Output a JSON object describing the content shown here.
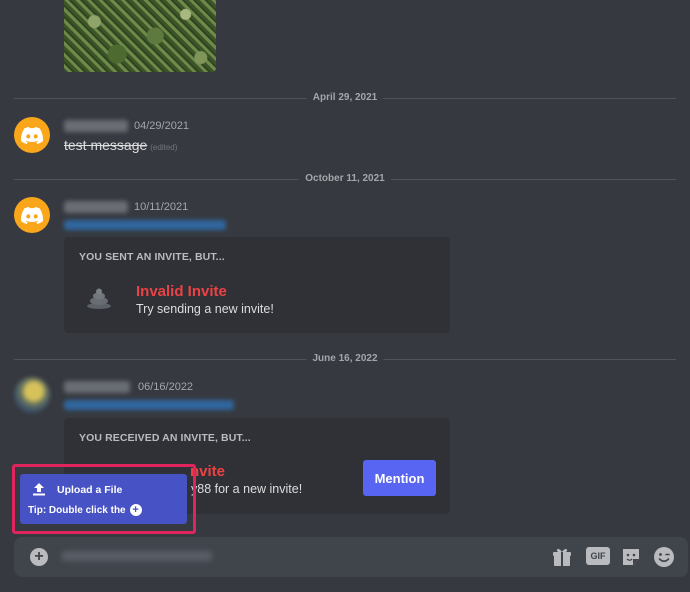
{
  "dividers": [
    {
      "label": "April 29, 2021"
    },
    {
      "label": "October 11, 2021"
    },
    {
      "label": "June 16, 2022"
    }
  ],
  "messages": [
    {
      "timestamp": "04/29/2021",
      "text": "test message",
      "edited": "(edited)"
    },
    {
      "timestamp": "10/11/2021"
    },
    {
      "timestamp": "06/16/2022"
    }
  ],
  "invite_sent": {
    "title": "YOU SENT AN INVITE, BUT...",
    "name": "Invalid Invite",
    "subtitle": "Try sending a new invite!"
  },
  "invite_received": {
    "title": "YOU RECEIVED AN INVITE, BUT...",
    "name_partial": "nvite",
    "subtitle_partial": "y88 for a new invite!",
    "mention_label": "Mention"
  },
  "upload_popup": {
    "upload_label": "Upload a File",
    "tip_text": "Tip: Double click the"
  },
  "composer": {
    "gif_label": "GIF"
  },
  "colors": {
    "background": "#36393f",
    "card": "#2f3136",
    "accent": "#5865f2",
    "danger": "#ed4245",
    "highlight": "#e0245e",
    "avatar": "#faa61a"
  }
}
